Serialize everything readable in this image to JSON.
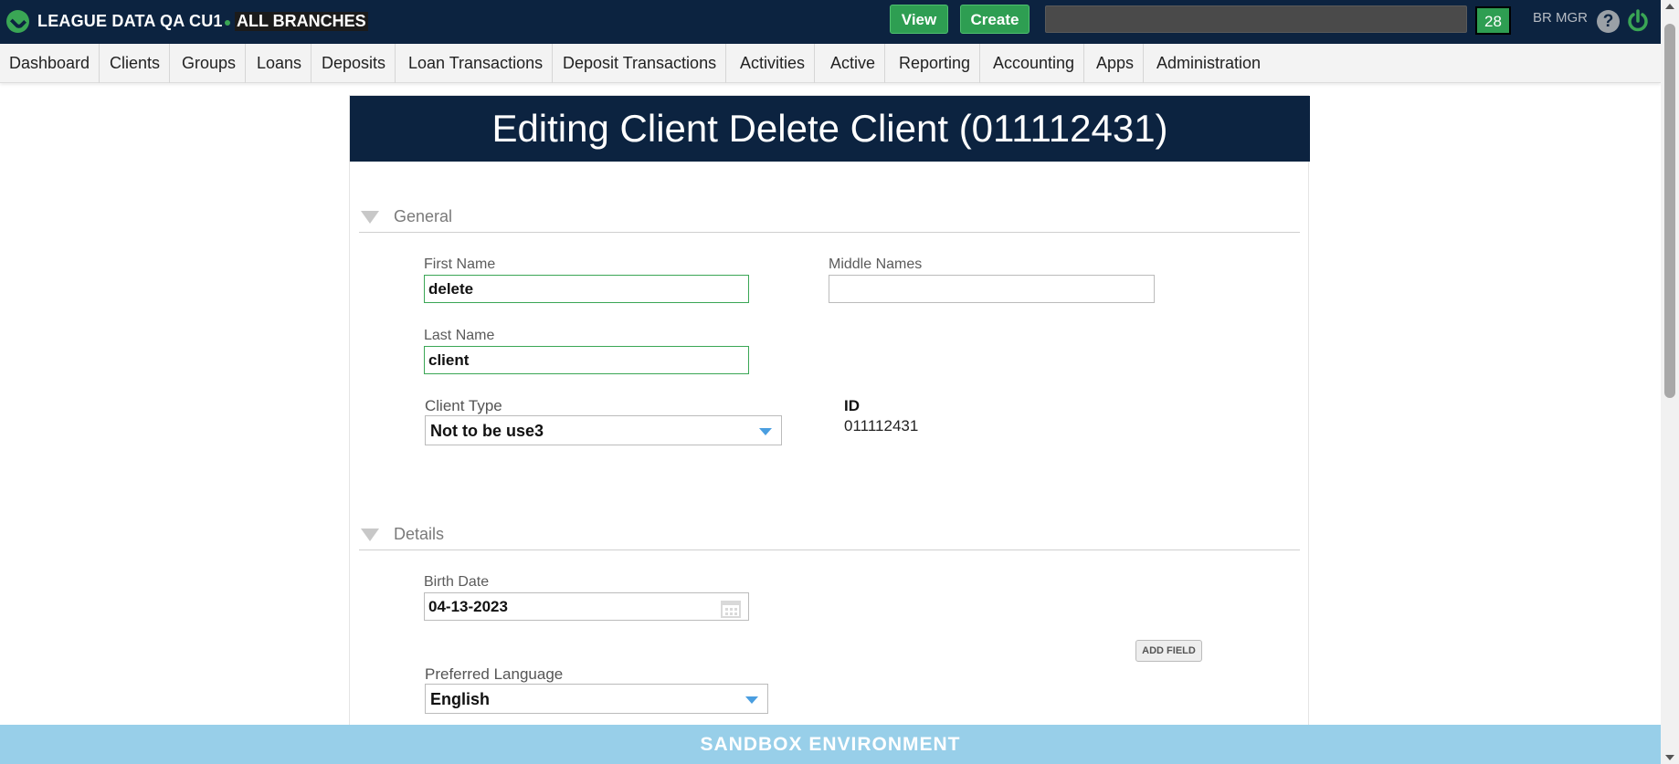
{
  "topbar": {
    "org_name": "LEAGUE DATA QA CU1",
    "branch": "ALL BRANCHES",
    "view_label": "View",
    "create_label": "Create",
    "notification_count": "28",
    "user": "BR MGR",
    "help_glyph": "?",
    "brand_color": "#0c2340",
    "accent_color": "#2e9e52"
  },
  "nav": {
    "items": [
      {
        "label": "Dashboard"
      },
      {
        "label": "Clients"
      },
      {
        "label": "Groups"
      },
      {
        "label": "Loans"
      },
      {
        "label": "Deposits"
      },
      {
        "label": "Loan Transactions"
      },
      {
        "label": "Deposit Transactions"
      },
      {
        "label": "Activities"
      },
      {
        "label": "Active"
      },
      {
        "label": "Reporting"
      },
      {
        "label": "Accounting"
      },
      {
        "label": "Apps"
      },
      {
        "label": "Administration"
      }
    ]
  },
  "form": {
    "title": "Editing Client Delete Client (011112431)",
    "general": {
      "section_title": "General",
      "first_name_label": "First Name",
      "first_name_value": "delete",
      "middle_names_label": "Middle Names",
      "middle_names_value": "",
      "last_name_label": "Last Name",
      "last_name_value": "client",
      "client_type_label": "Client Type",
      "client_type_value": "Not to be use3",
      "id_label": "ID",
      "id_value": "011112431"
    },
    "details": {
      "section_title": "Details",
      "birth_date_label": "Birth Date",
      "birth_date_value": "04-13-2023",
      "add_field_label": "ADD FIELD",
      "preferred_language_label": "Preferred Language",
      "preferred_language_value": "English"
    }
  },
  "footer": {
    "environment": "SANDBOX ENVIRONMENT",
    "color": "#98cfe9"
  }
}
